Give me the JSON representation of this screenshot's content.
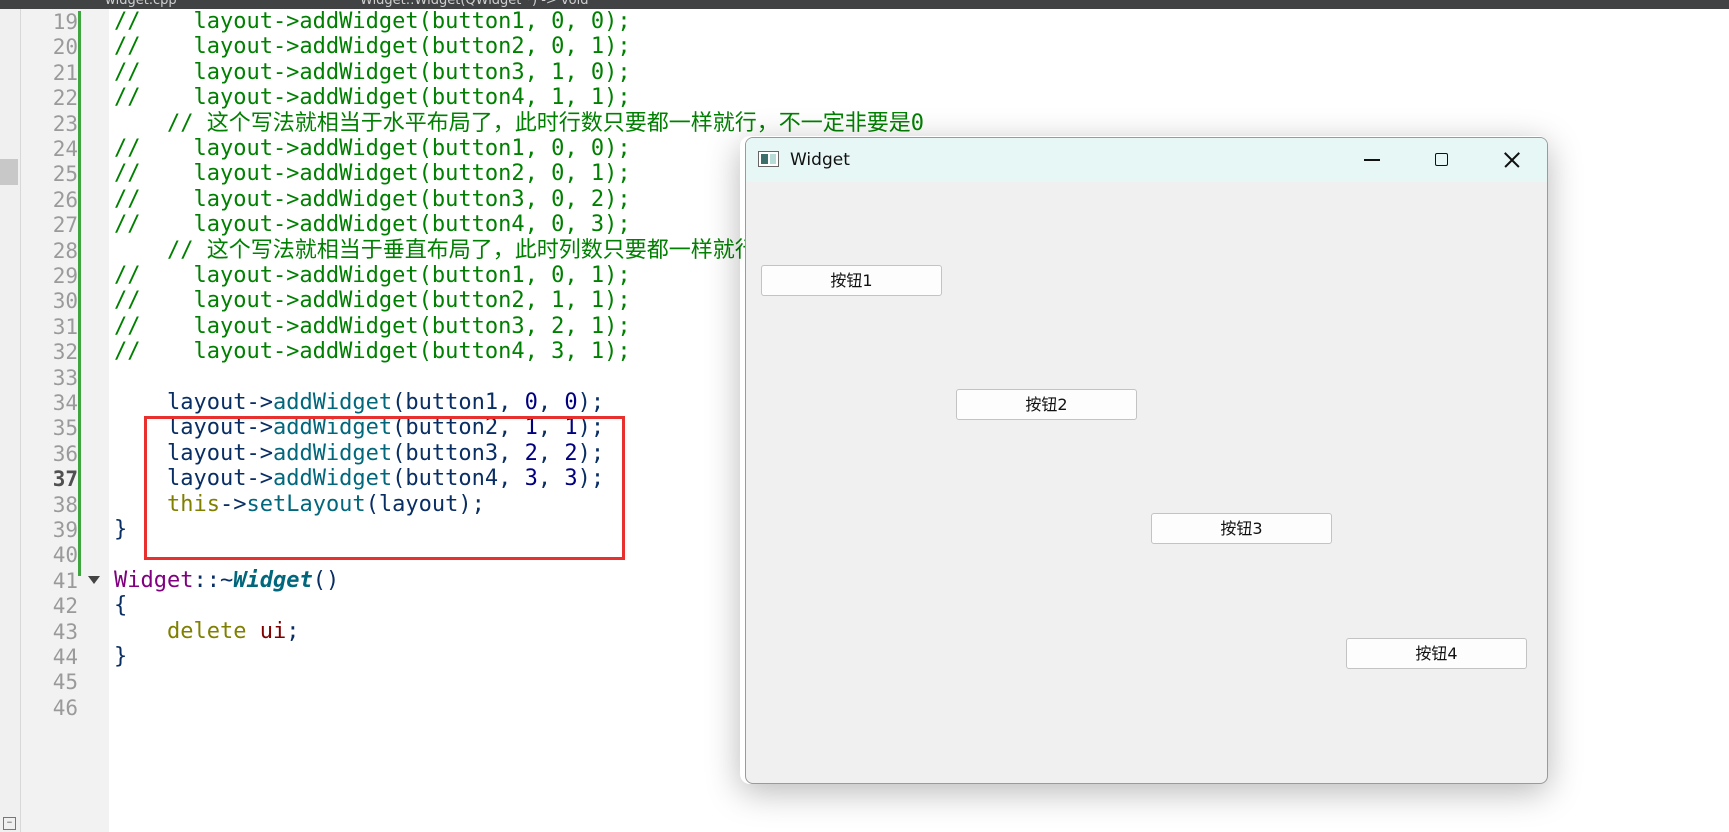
{
  "editor": {
    "tabs": [
      {
        "label": "widget.cpp"
      },
      {
        "label": "Widget::Widget(QWidget *) -> void"
      }
    ],
    "current_line": "37",
    "lines": [
      {
        "n": "19",
        "parts": [
          {
            "c": "comment",
            "t": "//    layout->addWidget(button1, 0, 0);"
          }
        ]
      },
      {
        "n": "20",
        "parts": [
          {
            "c": "comment",
            "t": "//    layout->addWidget(button2, 0, 1);"
          }
        ]
      },
      {
        "n": "21",
        "parts": [
          {
            "c": "comment",
            "t": "//    layout->addWidget(button3, 1, 0);"
          }
        ]
      },
      {
        "n": "22",
        "parts": [
          {
            "c": "comment",
            "t": "//    layout->addWidget(button4, 1, 1);"
          }
        ]
      },
      {
        "n": "23",
        "parts": [
          {
            "c": "comment",
            "t": "    // 这个写法就相当于水平布局了，此时行数只要都一样就行，不一定非要是0"
          }
        ]
      },
      {
        "n": "24",
        "parts": [
          {
            "c": "comment",
            "t": "//    layout->addWidget(button1, 0, 0);"
          }
        ]
      },
      {
        "n": "25",
        "parts": [
          {
            "c": "comment",
            "t": "//    layout->addWidget(button2, 0, 1);"
          }
        ]
      },
      {
        "n": "26",
        "parts": [
          {
            "c": "comment",
            "t": "//    layout->addWidget(button3, 0, 2);"
          }
        ]
      },
      {
        "n": "27",
        "parts": [
          {
            "c": "comment",
            "t": "//    layout->addWidget(button4, 0, 3);"
          }
        ]
      },
      {
        "n": "28",
        "parts": [
          {
            "c": "comment",
            "t": "    // 这个写法就相当于垂直布局了，此时列数只要都一样就行"
          }
        ]
      },
      {
        "n": "29",
        "parts": [
          {
            "c": "comment",
            "t": "//    layout->addWidget(button1, 0, 1);"
          }
        ]
      },
      {
        "n": "30",
        "parts": [
          {
            "c": "comment",
            "t": "//    layout->addWidget(button2, 1, 1);"
          }
        ]
      },
      {
        "n": "31",
        "parts": [
          {
            "c": "comment",
            "t": "//    layout->addWidget(button3, 2, 1);"
          }
        ]
      },
      {
        "n": "32",
        "parts": [
          {
            "c": "comment",
            "t": "//    layout->addWidget(button4, 3, 1);"
          }
        ]
      },
      {
        "n": "33",
        "parts": []
      },
      {
        "n": "34",
        "parts": [
          {
            "c": "var",
            "t": "    layout->"
          },
          {
            "c": "fn",
            "t": "addWidget"
          },
          {
            "c": "var",
            "t": "(button1, "
          },
          {
            "c": "num",
            "t": "0"
          },
          {
            "c": "var",
            "t": ", "
          },
          {
            "c": "num",
            "t": "0"
          },
          {
            "c": "var",
            "t": ");"
          }
        ]
      },
      {
        "n": "35",
        "parts": [
          {
            "c": "var",
            "t": "    layout->"
          },
          {
            "c": "fn",
            "t": "addWidget"
          },
          {
            "c": "var",
            "t": "(button2, "
          },
          {
            "c": "num",
            "t": "1"
          },
          {
            "c": "var",
            "t": ", "
          },
          {
            "c": "num",
            "t": "1"
          },
          {
            "c": "var",
            "t": ");"
          }
        ]
      },
      {
        "n": "36",
        "parts": [
          {
            "c": "var",
            "t": "    layout->"
          },
          {
            "c": "fn",
            "t": "addWidget"
          },
          {
            "c": "var",
            "t": "(button3, "
          },
          {
            "c": "num",
            "t": "2"
          },
          {
            "c": "var",
            "t": ", "
          },
          {
            "c": "num",
            "t": "2"
          },
          {
            "c": "var",
            "t": ");"
          }
        ]
      },
      {
        "n": "37",
        "parts": [
          {
            "c": "var",
            "t": "    layout->"
          },
          {
            "c": "fn",
            "t": "addWidget"
          },
          {
            "c": "var",
            "t": "(button4, "
          },
          {
            "c": "num",
            "t": "3"
          },
          {
            "c": "var",
            "t": ", "
          },
          {
            "c": "num",
            "t": "3"
          },
          {
            "c": "var",
            "t": ");"
          }
        ]
      },
      {
        "n": "38",
        "parts": [
          {
            "c": "kw",
            "t": "    this"
          },
          {
            "c": "var",
            "t": "->"
          },
          {
            "c": "fn",
            "t": "setLayout"
          },
          {
            "c": "var",
            "t": "(layout);"
          }
        ]
      },
      {
        "n": "39",
        "parts": [
          {
            "c": "var",
            "t": "}"
          }
        ]
      },
      {
        "n": "40",
        "parts": []
      },
      {
        "n": "41",
        "fold": true,
        "parts": [
          {
            "c": "ty",
            "t": "Widget"
          },
          {
            "c": "var",
            "t": "::~"
          },
          {
            "c": "fnd",
            "t": "Widget"
          },
          {
            "c": "var",
            "t": "()"
          }
        ]
      },
      {
        "n": "42",
        "parts": [
          {
            "c": "var",
            "t": "{"
          }
        ]
      },
      {
        "n": "43",
        "parts": [
          {
            "c": "kw",
            "t": "    delete"
          },
          {
            "c": "var",
            "t": " "
          },
          {
            "c": "ui",
            "t": "ui"
          },
          {
            "c": "var",
            "t": ";"
          }
        ]
      },
      {
        "n": "44",
        "parts": [
          {
            "c": "var",
            "t": "}"
          }
        ]
      },
      {
        "n": "45",
        "parts": []
      },
      {
        "n": "46",
        "parts": []
      }
    ]
  },
  "widget_window": {
    "title": "Widget",
    "buttons": [
      "按钮1",
      "按钮2",
      "按钮3",
      "按钮4"
    ]
  }
}
